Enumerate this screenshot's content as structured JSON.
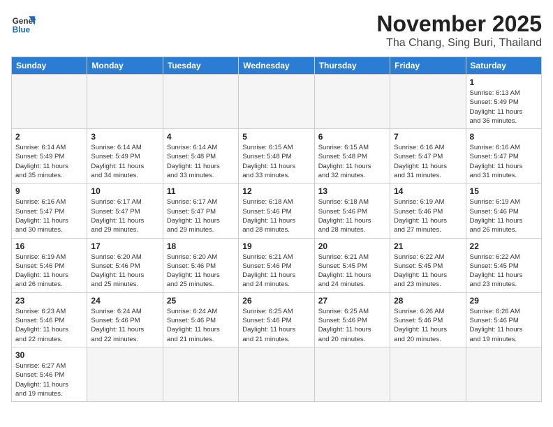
{
  "header": {
    "logo_line1": "General",
    "logo_line2": "Blue",
    "month": "November 2025",
    "location": "Tha Chang, Sing Buri, Thailand"
  },
  "weekdays": [
    "Sunday",
    "Monday",
    "Tuesday",
    "Wednesday",
    "Thursday",
    "Friday",
    "Saturday"
  ],
  "weeks": [
    [
      {
        "day": "",
        "info": ""
      },
      {
        "day": "",
        "info": ""
      },
      {
        "day": "",
        "info": ""
      },
      {
        "day": "",
        "info": ""
      },
      {
        "day": "",
        "info": ""
      },
      {
        "day": "",
        "info": ""
      },
      {
        "day": "1",
        "info": "Sunrise: 6:13 AM\nSunset: 5:49 PM\nDaylight: 11 hours\nand 36 minutes."
      }
    ],
    [
      {
        "day": "2",
        "info": "Sunrise: 6:14 AM\nSunset: 5:49 PM\nDaylight: 11 hours\nand 35 minutes."
      },
      {
        "day": "3",
        "info": "Sunrise: 6:14 AM\nSunset: 5:49 PM\nDaylight: 11 hours\nand 34 minutes."
      },
      {
        "day": "4",
        "info": "Sunrise: 6:14 AM\nSunset: 5:48 PM\nDaylight: 11 hours\nand 33 minutes."
      },
      {
        "day": "5",
        "info": "Sunrise: 6:15 AM\nSunset: 5:48 PM\nDaylight: 11 hours\nand 33 minutes."
      },
      {
        "day": "6",
        "info": "Sunrise: 6:15 AM\nSunset: 5:48 PM\nDaylight: 11 hours\nand 32 minutes."
      },
      {
        "day": "7",
        "info": "Sunrise: 6:16 AM\nSunset: 5:47 PM\nDaylight: 11 hours\nand 31 minutes."
      },
      {
        "day": "8",
        "info": "Sunrise: 6:16 AM\nSunset: 5:47 PM\nDaylight: 11 hours\nand 31 minutes."
      }
    ],
    [
      {
        "day": "9",
        "info": "Sunrise: 6:16 AM\nSunset: 5:47 PM\nDaylight: 11 hours\nand 30 minutes."
      },
      {
        "day": "10",
        "info": "Sunrise: 6:17 AM\nSunset: 5:47 PM\nDaylight: 11 hours\nand 29 minutes."
      },
      {
        "day": "11",
        "info": "Sunrise: 6:17 AM\nSunset: 5:47 PM\nDaylight: 11 hours\nand 29 minutes."
      },
      {
        "day": "12",
        "info": "Sunrise: 6:18 AM\nSunset: 5:46 PM\nDaylight: 11 hours\nand 28 minutes."
      },
      {
        "day": "13",
        "info": "Sunrise: 6:18 AM\nSunset: 5:46 PM\nDaylight: 11 hours\nand 28 minutes."
      },
      {
        "day": "14",
        "info": "Sunrise: 6:19 AM\nSunset: 5:46 PM\nDaylight: 11 hours\nand 27 minutes."
      },
      {
        "day": "15",
        "info": "Sunrise: 6:19 AM\nSunset: 5:46 PM\nDaylight: 11 hours\nand 26 minutes."
      }
    ],
    [
      {
        "day": "16",
        "info": "Sunrise: 6:19 AM\nSunset: 5:46 PM\nDaylight: 11 hours\nand 26 minutes."
      },
      {
        "day": "17",
        "info": "Sunrise: 6:20 AM\nSunset: 5:46 PM\nDaylight: 11 hours\nand 25 minutes."
      },
      {
        "day": "18",
        "info": "Sunrise: 6:20 AM\nSunset: 5:46 PM\nDaylight: 11 hours\nand 25 minutes."
      },
      {
        "day": "19",
        "info": "Sunrise: 6:21 AM\nSunset: 5:46 PM\nDaylight: 11 hours\nand 24 minutes."
      },
      {
        "day": "20",
        "info": "Sunrise: 6:21 AM\nSunset: 5:45 PM\nDaylight: 11 hours\nand 24 minutes."
      },
      {
        "day": "21",
        "info": "Sunrise: 6:22 AM\nSunset: 5:45 PM\nDaylight: 11 hours\nand 23 minutes."
      },
      {
        "day": "22",
        "info": "Sunrise: 6:22 AM\nSunset: 5:45 PM\nDaylight: 11 hours\nand 23 minutes."
      }
    ],
    [
      {
        "day": "23",
        "info": "Sunrise: 6:23 AM\nSunset: 5:46 PM\nDaylight: 11 hours\nand 22 minutes."
      },
      {
        "day": "24",
        "info": "Sunrise: 6:24 AM\nSunset: 5:46 PM\nDaylight: 11 hours\nand 22 minutes."
      },
      {
        "day": "25",
        "info": "Sunrise: 6:24 AM\nSunset: 5:46 PM\nDaylight: 11 hours\nand 21 minutes."
      },
      {
        "day": "26",
        "info": "Sunrise: 6:25 AM\nSunset: 5:46 PM\nDaylight: 11 hours\nand 21 minutes."
      },
      {
        "day": "27",
        "info": "Sunrise: 6:25 AM\nSunset: 5:46 PM\nDaylight: 11 hours\nand 20 minutes."
      },
      {
        "day": "28",
        "info": "Sunrise: 6:26 AM\nSunset: 5:46 PM\nDaylight: 11 hours\nand 20 minutes."
      },
      {
        "day": "29",
        "info": "Sunrise: 6:26 AM\nSunset: 5:46 PM\nDaylight: 11 hours\nand 19 minutes."
      }
    ],
    [
      {
        "day": "30",
        "info": "Sunrise: 6:27 AM\nSunset: 5:46 PM\nDaylight: 11 hours\nand 19 minutes."
      },
      {
        "day": "",
        "info": ""
      },
      {
        "day": "",
        "info": ""
      },
      {
        "day": "",
        "info": ""
      },
      {
        "day": "",
        "info": ""
      },
      {
        "day": "",
        "info": ""
      },
      {
        "day": "",
        "info": ""
      }
    ]
  ]
}
